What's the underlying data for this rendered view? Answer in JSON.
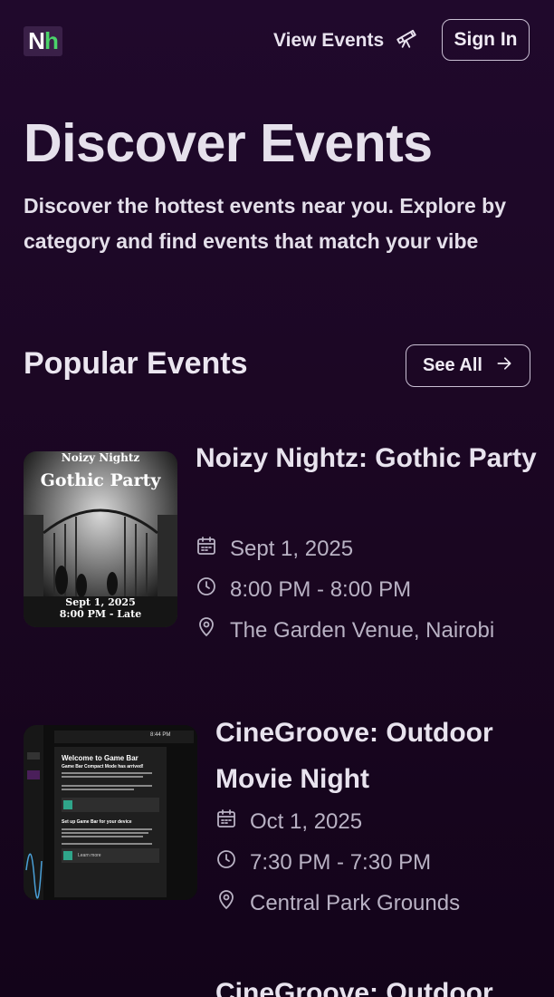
{
  "nav": {
    "logo_n": "N",
    "logo_h": "h",
    "view_events_label": "View Events",
    "view_events_icon": "telescope-icon",
    "signin_label": "Sign In"
  },
  "hero": {
    "title": "Discover Events",
    "subtitle": "Discover the hottest events near you. Explore by category and find events that match your vibe"
  },
  "popular": {
    "title": "Popular Events",
    "see_all_label": "See All",
    "see_all_icon": "arrow-right-icon"
  },
  "events": [
    {
      "title": "Noizy Nightz: Gothic Party",
      "date": "Sept 1, 2025",
      "time": "8:00 PM - 8:00 PM",
      "venue": "The Garden Venue, Nairobi",
      "poster": {
        "top_text": "Noizy Nightz",
        "headline": "Gothic Party",
        "date_line": "Sept 1, 2025",
        "time_line": "8:00 PM - Late"
      }
    },
    {
      "title": "CineGroove: Outdoor Movie Night",
      "date": "Oct 1, 2025",
      "time": "7:30 PM - 7:30 PM",
      "venue": "Central Park Grounds",
      "poster": {
        "panel_time": "8:44 PM",
        "panel_heading": "Welcome to Game Bar",
        "panel_subheading": "Game Bar Compact Mode has arrived!",
        "panel_section": "Set up Game Bar for your device",
        "panel_link": "Learn more"
      }
    },
    {
      "title": "CineGroove: Outdoor"
    }
  ],
  "colors": {
    "background": "#1a0621",
    "accent_green": "#4bd36a",
    "text_primary": "#e8e3ee",
    "text_muted": "#b9b2c4"
  }
}
